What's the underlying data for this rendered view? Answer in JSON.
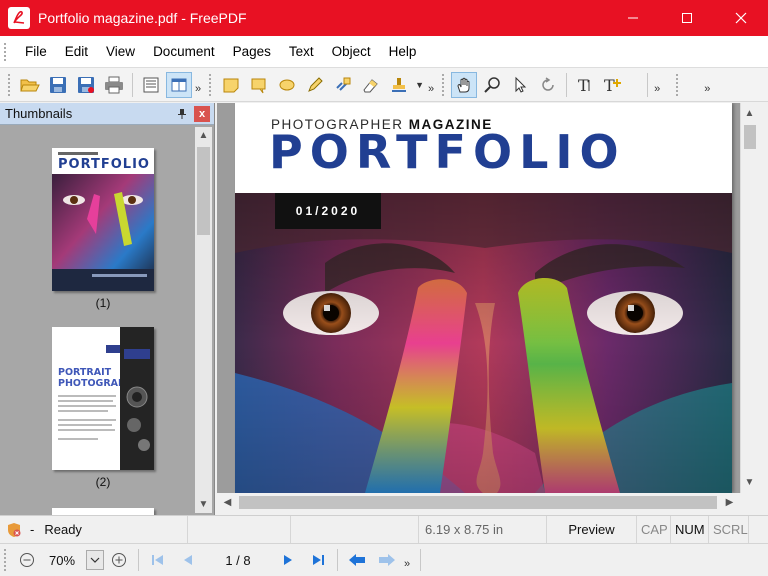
{
  "window": {
    "title": "Portfolio magazine.pdf - FreePDF"
  },
  "menu": [
    "File",
    "Edit",
    "View",
    "Document",
    "Pages",
    "Text",
    "Object",
    "Help"
  ],
  "toolbar": {
    "more": "»",
    "groups": [
      [
        "open-icon",
        "save-icon",
        "save-as-icon",
        "print-icon"
      ],
      [
        "single-page-icon",
        "two-page-icon"
      ],
      [
        "note-icon",
        "callout-icon",
        "cloud-icon",
        "pencil-icon",
        "link-icon",
        "eraser-icon",
        "stamp-icon"
      ],
      [
        "hand-icon",
        "zoom-icon",
        "select-icon",
        "rotate-icon"
      ],
      [
        "text-icon",
        "add-text-icon"
      ]
    ]
  },
  "thumbnails": {
    "header": "Thumbnails",
    "pages": [
      {
        "label": "(1)",
        "title": "PORTFOLIO"
      },
      {
        "label": "(2)",
        "title_line1": "PORTRAIT",
        "title_line2": "PHOTOGRAPHY"
      }
    ]
  },
  "document": {
    "kicker_light": "PHOTOGRAPHER ",
    "kicker_bold": "MAGAZINE",
    "headline": "PORTFOLIO",
    "issue": "01/2020"
  },
  "status": {
    "state": "Ready",
    "dash": "-",
    "size": "6.19 x 8.75 in",
    "mode": "Preview",
    "cap": "CAP",
    "num": "NUM",
    "scrl": "SCRL"
  },
  "nav": {
    "zoom": "70%",
    "page": "1 / 8",
    "more": "»"
  },
  "colors": {
    "titlebar": "#e81123",
    "brand_blue": "#213f92",
    "accent_blue": "#1e73d8"
  }
}
